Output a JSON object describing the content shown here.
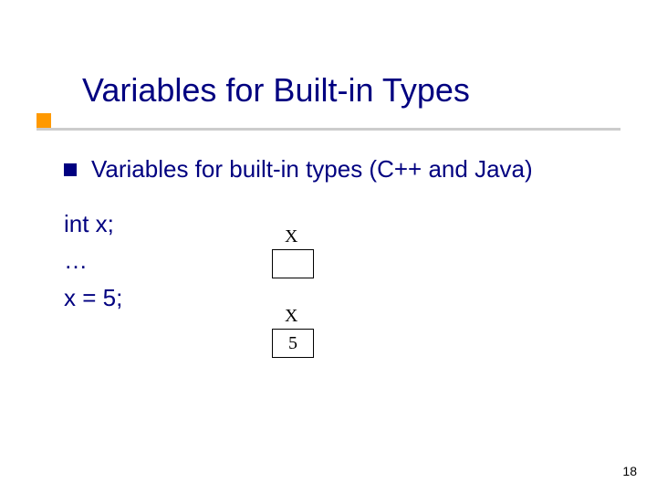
{
  "title": "Variables for Built-in Types",
  "bullet1": "Variables for built-in types (C++ and Java)",
  "code": {
    "line1": "int x;",
    "line2": "…",
    "line3": "x = 5;"
  },
  "diagram": {
    "label1": "X",
    "box1": "",
    "label2": "X",
    "box2": "5"
  },
  "page_number": "18"
}
